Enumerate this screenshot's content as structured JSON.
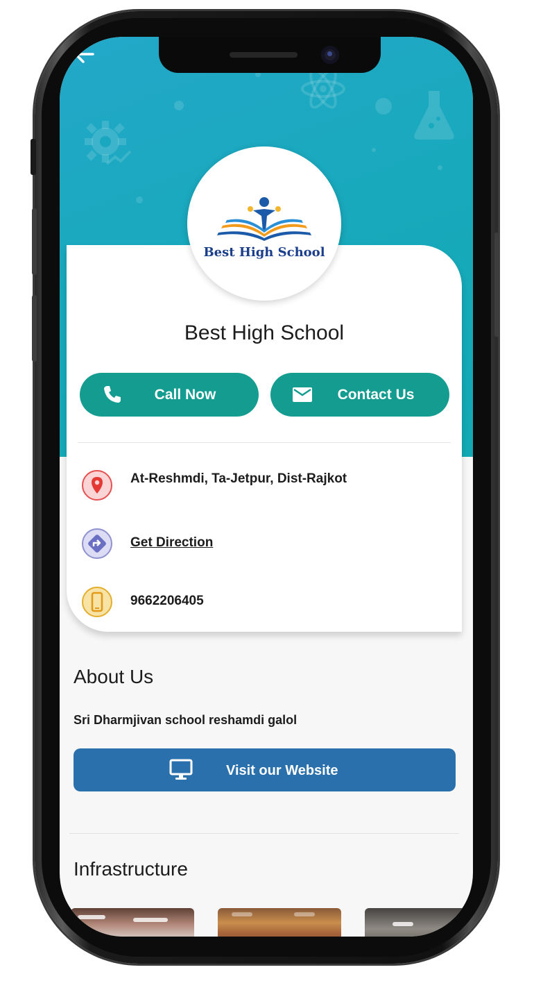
{
  "school": {
    "name": "Best High School",
    "logo_text": "Best High School"
  },
  "actions": {
    "call_label": "Call Now",
    "contact_label": "Contact Us"
  },
  "info": {
    "address": "At-Reshmdi, Ta-Jetpur, Dist-Rajkot",
    "direction_label": "Get Direction",
    "phone": "9662206405"
  },
  "about": {
    "title": "About Us",
    "description": "Sri Dharmjivan school reshamdi galol",
    "website_label": "Visit our Website"
  },
  "infrastructure": {
    "title": "Infrastructure"
  },
  "icons": [
    "back-arrow-icon",
    "gear-icon",
    "atom-icon",
    "flask-icon",
    "phone-icon",
    "mail-icon",
    "location-pin-icon",
    "direction-icon",
    "mobile-icon",
    "monitor-icon"
  ],
  "colors": {
    "hero_teal": "#18a9bf",
    "action_green": "#139c8f",
    "website_blue": "#2970ad",
    "location_red": "#e53935",
    "direction_purple": "#6a6fc4",
    "mobile_amber": "#e5ad2c"
  }
}
